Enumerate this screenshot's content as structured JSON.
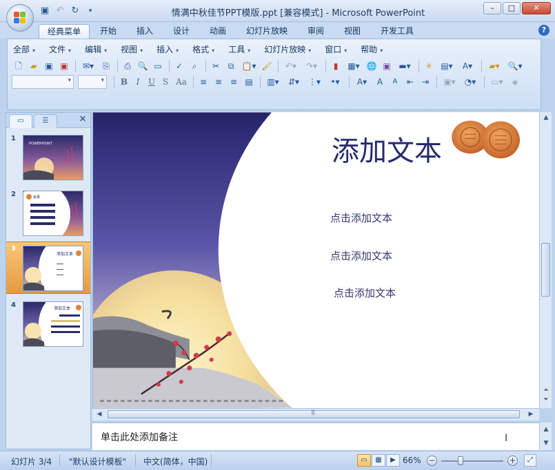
{
  "window": {
    "title": "情满中秋佳节PPT模版.ppt [兼容模式] - Microsoft PowerPoint"
  },
  "ribbon_tabs": [
    "经典菜单",
    "开始",
    "插入",
    "设计",
    "动画",
    "幻灯片放映",
    "审阅",
    "视图",
    "开发工具"
  ],
  "active_tab": "经典菜单",
  "classic_menu": [
    "全部",
    "文件",
    "编辑",
    "视图",
    "插入",
    "格式",
    "工具",
    "幻灯片放映",
    "窗口",
    "帮助"
  ],
  "format_buttons": [
    "B",
    "I",
    "U",
    "S",
    "Aa"
  ],
  "slides": [
    {
      "number": "1",
      "thumb_title": "POWERPOINT"
    },
    {
      "number": "2",
      "thumb_title": "目录"
    },
    {
      "number": "3",
      "thumb_title": "添加文本"
    },
    {
      "number": "4",
      "thumb_title": "添加文本"
    }
  ],
  "selected_slide": 3,
  "current_slide": {
    "title": "添加文本",
    "bullets": [
      "点击添加文本",
      "点击添加文本",
      "点击添加文本"
    ]
  },
  "notes": {
    "placeholder": "单击此处添加备注"
  },
  "status": {
    "slide_indicator": "幻灯片 3/4",
    "template": "\"默认设计模板\"",
    "language": "中文(简体，中国)",
    "zoom": "66%"
  },
  "colors": {
    "accent": "#2b5797",
    "slide_title": "#262a6f",
    "selected_thumb": "#e59a3f"
  }
}
